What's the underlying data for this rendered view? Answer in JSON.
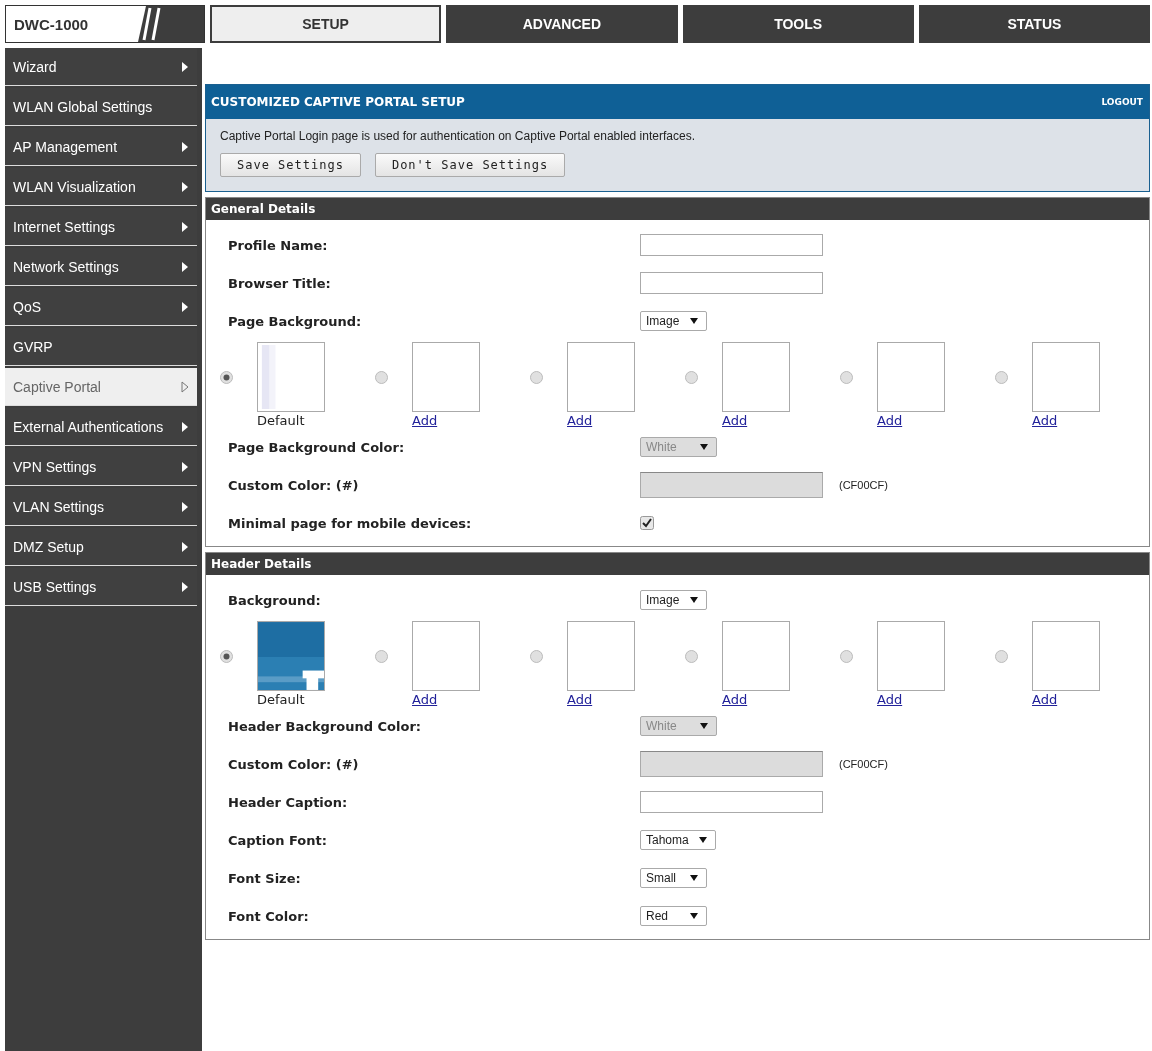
{
  "logo": {
    "text": "DWC-1000"
  },
  "tabs": [
    {
      "label": "SETUP",
      "selected": true
    },
    {
      "label": "ADVANCED",
      "selected": false
    },
    {
      "label": "TOOLS",
      "selected": false
    },
    {
      "label": "STATUS",
      "selected": false
    }
  ],
  "sidebar": {
    "items": [
      {
        "label": "Wizard",
        "selected": false
      },
      {
        "label": "WLAN Global Settings",
        "selected": false,
        "arrow": false
      },
      {
        "label": "AP Management",
        "selected": false
      },
      {
        "label": "WLAN Visualization",
        "selected": false
      },
      {
        "label": "Internet Settings",
        "selected": false
      },
      {
        "label": "Network Settings",
        "selected": false
      },
      {
        "label": "QoS",
        "selected": false
      },
      {
        "label": "GVRP",
        "selected": false,
        "arrow": false
      },
      {
        "label": "Captive Portal",
        "selected": true
      },
      {
        "label": "External Authentications",
        "selected": false
      },
      {
        "label": "VPN Settings",
        "selected": false
      },
      {
        "label": "VLAN Settings",
        "selected": false
      },
      {
        "label": "DMZ Setup",
        "selected": false
      },
      {
        "label": "USB Settings",
        "selected": false
      }
    ]
  },
  "panel": {
    "title": "CUSTOMIZED CAPTIVE PORTAL SETUP",
    "logout": "LOGOUT",
    "description": "Captive Portal Login page is used for authentication on Captive Portal enabled interfaces.",
    "buttons": [
      "Save Settings",
      "Don't Save Settings"
    ]
  },
  "sections": [
    {
      "title": "General Details",
      "rows": [
        {
          "kind": "text",
          "label": "Profile Name:"
        },
        {
          "kind": "text",
          "label": "Browser Title:"
        },
        {
          "kind": "select",
          "label": "Page Background:",
          "value": "Image",
          "disabled": false
        },
        {
          "kind": "images",
          "options": [
            {
              "kind": "picture",
              "caption": "Default",
              "selected": true
            },
            {
              "kind": "empty",
              "caption": "Add",
              "selected": false
            },
            {
              "kind": "empty",
              "caption": "Add",
              "selected": false
            },
            {
              "kind": "empty",
              "caption": "Add",
              "selected": false
            },
            {
              "kind": "empty",
              "caption": "Add",
              "selected": false
            },
            {
              "kind": "empty",
              "caption": "Add",
              "selected": false
            }
          ]
        },
        {
          "kind": "select",
          "label": "Page Background Color:",
          "value": "White",
          "disabled": true
        },
        {
          "kind": "color",
          "label": "Custom Color: (#)",
          "hint": "(CF00CF)",
          "disabled": true
        },
        {
          "kind": "checkbox",
          "label": "Minimal page for mobile devices:",
          "checked": true
        }
      ]
    },
    {
      "title": "Header Details",
      "rows": [
        {
          "kind": "select",
          "label": "Background:",
          "value": "Image",
          "disabled": false
        },
        {
          "kind": "images",
          "options": [
            {
              "kind": "picture",
              "caption": "Default",
              "selected": true
            },
            {
              "kind": "empty",
              "caption": "Add",
              "selected": false
            },
            {
              "kind": "empty",
              "caption": "Add",
              "selected": false
            },
            {
              "kind": "empty",
              "caption": "Add",
              "selected": false
            },
            {
              "kind": "empty",
              "caption": "Add",
              "selected": false
            },
            {
              "kind": "empty",
              "caption": "Add",
              "selected": false
            }
          ]
        },
        {
          "kind": "select",
          "label": "Header Background Color:",
          "value": "White",
          "disabled": true
        },
        {
          "kind": "color",
          "label": "Custom Color: (#)",
          "hint": "(CF00CF)",
          "disabled": true
        },
        {
          "kind": "text",
          "label": "Header Caption:"
        },
        {
          "kind": "select",
          "label": "Caption Font:",
          "value": "Tahoma",
          "disabled": false
        },
        {
          "kind": "select",
          "label": "Font Size:",
          "value": "Small",
          "disabled": false
        },
        {
          "kind": "select",
          "label": "Font Color:",
          "value": "Red",
          "disabled": false
        }
      ]
    }
  ]
}
